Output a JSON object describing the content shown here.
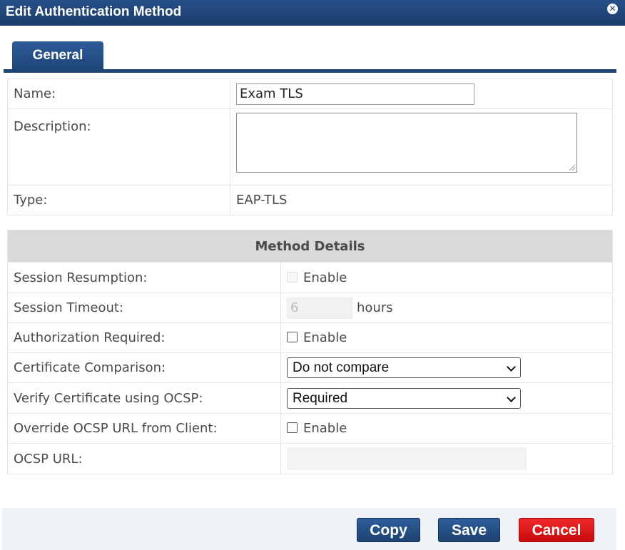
{
  "dialog": {
    "title": "Edit Authentication Method",
    "close_glyph": "⊗"
  },
  "tabs": [
    {
      "label": "General",
      "active": true
    }
  ],
  "general": {
    "name_label": "Name:",
    "name_value": "Exam TLS",
    "description_label": "Description:",
    "description_value": "",
    "type_label": "Type:",
    "type_value": "EAP-TLS"
  },
  "method_details": {
    "header": "Method Details",
    "session_resumption": {
      "label": "Session Resumption:",
      "option": "Enable",
      "checked": false,
      "disabled": true
    },
    "session_timeout": {
      "label": "Session Timeout:",
      "value": "6",
      "unit": "hours",
      "disabled": true
    },
    "authorization_required": {
      "label": "Authorization Required:",
      "option": "Enable",
      "checked": false
    },
    "certificate_comparison": {
      "label": "Certificate Comparison:",
      "selected": "Do not compare"
    },
    "verify_ocsp": {
      "label": "Verify Certificate using OCSP:",
      "selected": "Required"
    },
    "override_ocsp_url": {
      "label": "Override OCSP URL from Client:",
      "option": "Enable",
      "checked": false
    },
    "ocsp_url": {
      "label": "OCSP URL:",
      "value": "",
      "disabled": true
    }
  },
  "buttons": {
    "copy": "Copy",
    "save": "Save",
    "cancel": "Cancel"
  },
  "colors": {
    "header_blue": "#1f4577",
    "cancel_red": "#e01818",
    "section_gray": "#d9d9d9"
  }
}
